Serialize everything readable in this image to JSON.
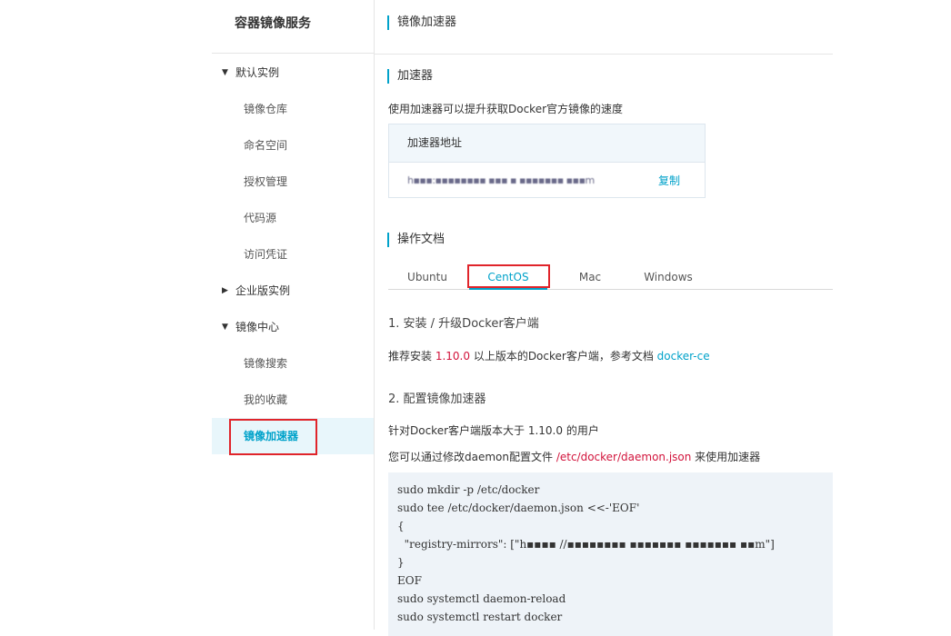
{
  "sidebar": {
    "title": "容器镜像服务",
    "groups": [
      {
        "label": "默认实例",
        "arrow": "▼"
      },
      {
        "label": "企业版实例",
        "arrow": "▶"
      },
      {
        "label": "镜像中心",
        "arrow": "▼"
      }
    ],
    "items": [
      {
        "label": "镜像仓库"
      },
      {
        "label": "命名空间"
      },
      {
        "label": "授权管理"
      },
      {
        "label": "代码源"
      },
      {
        "label": "访问凭证"
      },
      {
        "label": "镜像搜索"
      },
      {
        "label": "我的收藏"
      },
      {
        "label": "镜像加速器"
      }
    ]
  },
  "main": {
    "page_title": "镜像加速器",
    "accelerator": {
      "heading": "加速器",
      "description": "使用加速器可以提升获取Docker官方镜像的速度",
      "box_header": "加速器地址",
      "address_redacted": "h▪▪▪:▪▪▪▪▪▪▪▪ ▪▪▪ ▪ ▪▪▪▪▪▪▪ ▪▪▪m",
      "copy_label": "复制"
    },
    "docs": {
      "heading": "操作文档",
      "tabs": [
        "Ubuntu",
        "CentOS",
        "Mac",
        "Windows"
      ],
      "active_tab": "CentOS",
      "step1_title": "1. 安装 / 升级Docker客户端",
      "step1_text_a": "推荐安装 ",
      "step1_version": "1.10.0",
      "step1_text_b": " 以上版本的Docker客户端，参考文档 ",
      "step1_link": "docker-ce",
      "step2_title": "2. 配置镜像加速器",
      "step2_line1": "针对Docker客户端版本大于 1.10.0 的用户",
      "step2_line2_a": "您可以通过修改daemon配置文件 ",
      "step2_path": "/etc/docker/daemon.json",
      "step2_line2_b": " 来使用加速器",
      "code": [
        "sudo mkdir -p /etc/docker",
        "sudo tee /etc/docker/daemon.json <<-'EOF'",
        "{",
        "  \"registry-mirrors\": [\"h▪▪▪▪ //▪▪▪▪▪▪▪▪ ▪▪▪▪▪▪▪ ▪▪▪▪▪▪▪ ▪▪m\"]",
        "}",
        "EOF",
        "sudo systemctl daemon-reload",
        "sudo systemctl restart docker"
      ]
    }
  },
  "colors": {
    "accent": "#00a2ca",
    "highlight_box": "#e0242a",
    "emphasis_text": "#d2143c",
    "active_bg": "#e8f6fb",
    "code_bg": "#eef3f8"
  }
}
